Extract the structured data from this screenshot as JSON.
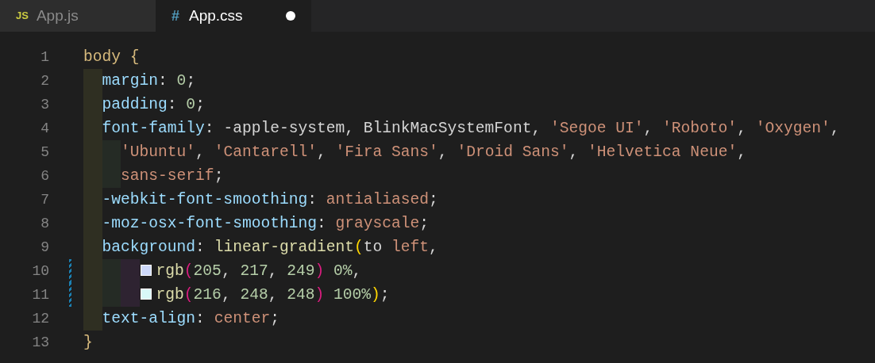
{
  "tabs": [
    {
      "icon": "JS",
      "kind": "js",
      "label": "App.js",
      "selected": false,
      "modified": false
    },
    {
      "icon": "#",
      "kind": "css",
      "label": "App.css",
      "selected": true,
      "modified": true
    }
  ],
  "lines": [
    {
      "number": "1",
      "tokens": [
        {
          "kind": "selector",
          "text": "body {"
        }
      ],
      "children": [
        {
          "number": "2",
          "tokens": [
            {
              "kind": "property",
              "text": "margin"
            },
            {
              "kind": "punct",
              "text": ": "
            },
            {
              "kind": "number",
              "text": "0"
            },
            {
              "kind": "punct",
              "text": ";"
            }
          ]
        },
        {
          "number": "3",
          "tokens": [
            {
              "kind": "property",
              "text": "padding"
            },
            {
              "kind": "punct",
              "text": ": "
            },
            {
              "kind": "number",
              "text": "0"
            },
            {
              "kind": "punct",
              "text": ";"
            }
          ]
        },
        {
          "number": "4",
          "tokens": [
            {
              "kind": "property",
              "text": "font-family"
            },
            {
              "kind": "punct",
              "text": ": -apple-system, BlinkMacSystemFont, "
            },
            {
              "kind": "string",
              "text": "'Segoe UI'"
            },
            {
              "kind": "punct",
              "text": ", "
            },
            {
              "kind": "string",
              "text": "'Roboto'"
            },
            {
              "kind": "punct",
              "text": ", "
            },
            {
              "kind": "string",
              "text": "'Oxygen'"
            },
            {
              "kind": "punct",
              "text": ","
            }
          ],
          "children": [
            {
              "number": "5",
              "tokens": [
                {
                  "kind": "string",
                  "text": "'Ubuntu'"
                },
                {
                  "kind": "punct",
                  "text": ", "
                },
                {
                  "kind": "string",
                  "text": "'Cantarell'"
                },
                {
                  "kind": "punct",
                  "text": ", "
                },
                {
                  "kind": "string",
                  "text": "'Fira Sans'"
                },
                {
                  "kind": "punct",
                  "text": ", "
                },
                {
                  "kind": "string",
                  "text": "'Droid Sans'"
                },
                {
                  "kind": "punct",
                  "text": ", "
                },
                {
                  "kind": "string",
                  "text": "'Helvetica Neue'"
                },
                {
                  "kind": "punct",
                  "text": ","
                }
              ]
            },
            {
              "number": "6",
              "tokens": [
                {
                  "kind": "value",
                  "text": "sans-serif"
                },
                {
                  "kind": "punct",
                  "text": ";"
                }
              ]
            }
          ]
        },
        {
          "number": "7",
          "tokens": [
            {
              "kind": "property",
              "text": "-webkit-font-smoothing"
            },
            {
              "kind": "punct",
              "text": ": "
            },
            {
              "kind": "value",
              "text": "antialiased"
            },
            {
              "kind": "punct",
              "text": ";"
            }
          ]
        },
        {
          "number": "8",
          "tokens": [
            {
              "kind": "property",
              "text": "-moz-osx-font-smoothing"
            },
            {
              "kind": "punct",
              "text": ": "
            },
            {
              "kind": "value",
              "text": "grayscale"
            },
            {
              "kind": "punct",
              "text": ";"
            }
          ]
        },
        {
          "number": "9",
          "tokens": [
            {
              "kind": "property",
              "text": "background"
            },
            {
              "kind": "punct",
              "text": ": "
            },
            {
              "kind": "function",
              "text": "linear-gradient"
            },
            {
              "kind": "paren1",
              "text": "("
            },
            {
              "kind": "punct",
              "text": "to "
            },
            {
              "kind": "value",
              "text": "left"
            },
            {
              "kind": "punct",
              "text": ","
            }
          ],
          "children": [
            {
              "children": [
                {
                  "number": "10",
                  "modified": true,
                  "tokens": [
                    {
                      "kind": "swatch",
                      "color": "#cdd9f9"
                    },
                    {
                      "kind": "function",
                      "text": "rgb"
                    },
                    {
                      "kind": "paren2",
                      "text": "("
                    },
                    {
                      "kind": "number",
                      "text": "205"
                    },
                    {
                      "kind": "punct",
                      "text": ", "
                    },
                    {
                      "kind": "number",
                      "text": "217"
                    },
                    {
                      "kind": "punct",
                      "text": ", "
                    },
                    {
                      "kind": "number",
                      "text": "249"
                    },
                    {
                      "kind": "paren2",
                      "text": ") "
                    },
                    {
                      "kind": "number",
                      "text": "0%"
                    },
                    {
                      "kind": "punct",
                      "text": ","
                    }
                  ]
                },
                {
                  "number": "11",
                  "modified": true,
                  "tokens": [
                    {
                      "kind": "swatch",
                      "color": "#d8f8f8"
                    },
                    {
                      "kind": "function",
                      "text": "rgb"
                    },
                    {
                      "kind": "paren2",
                      "text": "("
                    },
                    {
                      "kind": "number",
                      "text": "216"
                    },
                    {
                      "kind": "punct",
                      "text": ", "
                    },
                    {
                      "kind": "number",
                      "text": "248"
                    },
                    {
                      "kind": "punct",
                      "text": ", "
                    },
                    {
                      "kind": "number",
                      "text": "248"
                    },
                    {
                      "kind": "paren2",
                      "text": ") "
                    },
                    {
                      "kind": "number",
                      "text": "100%"
                    },
                    {
                      "kind": "paren1",
                      "text": ")"
                    },
                    {
                      "kind": "punct",
                      "text": ";"
                    }
                  ]
                }
              ]
            }
          ]
        },
        {
          "number": "12",
          "tokens": [
            {
              "kind": "property",
              "text": "text-align"
            },
            {
              "kind": "punct",
              "text": ": "
            },
            {
              "kind": "value",
              "text": "center"
            },
            {
              "kind": "punct",
              "text": ";"
            }
          ]
        }
      ]
    },
    {
      "number": "13",
      "tokens": [
        {
          "kind": "selector",
          "text": "}"
        }
      ]
    }
  ]
}
